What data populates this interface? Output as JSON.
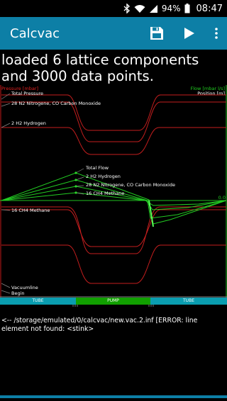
{
  "status_bar": {
    "battery_percent": "94%",
    "time": "08:47",
    "icons": [
      "bluetooth-icon",
      "wifi-icon",
      "signal-icon",
      "battery-icon"
    ]
  },
  "action_bar": {
    "title": "Calcvac",
    "actions": [
      "save-icon",
      "play-icon",
      "more-vert-icon"
    ],
    "color": "#0d7fa6"
  },
  "message": "loaded 6 lattice components and 3000 data points.",
  "plot": {
    "left_axis_label": "Pressure [mbar]",
    "right_axis_label_flow": "Flow [mbar l/s]",
    "right_axis_label_position": "Position [m]",
    "zero_label": "0.0",
    "pressure_labels": {
      "total": "Total Pressure",
      "n2co": "28 N2 Nitrogene, CO Carbon Monoxide",
      "h2": "2 H2 Hydrogen",
      "ch4": "16 CH4 Methane",
      "vacuum": "Vacuumline",
      "begin": "Begin"
    },
    "flow_labels": {
      "total": "Total Flow",
      "h2": "2 H2 Hydrogen",
      "n2co": "28 N2 Nitrogene, CO Carbon Monoxide",
      "ch4": "16 CH4 Methane"
    },
    "colors": {
      "pressure": "#e02020",
      "flow": "#20d020",
      "axis_left": "#e02020",
      "axis_right": "#20d020"
    }
  },
  "lattice": [
    {
      "label": "TUBE"
    },
    {
      "label": "PUMP"
    },
    {
      "label": "TUBE"
    }
  ],
  "log_text": "<-- /storage/emulated/0/calcvac/new.vac.2.inf [ERROR: line element not found: <stink>"
}
